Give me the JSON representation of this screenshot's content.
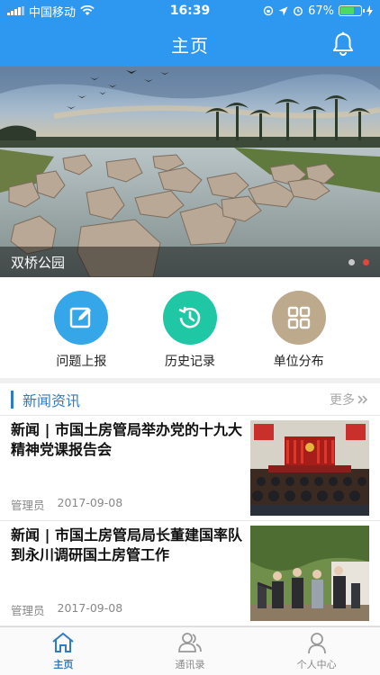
{
  "status_bar": {
    "carrier": "中国移动",
    "time": "16:39",
    "battery": "67%"
  },
  "header": {
    "title": "主页"
  },
  "banner": {
    "caption": "双桥公园",
    "slide_count": 2,
    "active_slide": 2
  },
  "quick_actions": [
    {
      "label": "问题上报",
      "icon": "edit-icon",
      "color": "#35a6e8"
    },
    {
      "label": "历史记录",
      "icon": "history-icon",
      "color": "#1fc7a5"
    },
    {
      "label": "单位分布",
      "icon": "grid-icon",
      "color": "#bda98c"
    }
  ],
  "news": {
    "section_title": "新闻资讯",
    "more_label": "更多",
    "items": [
      {
        "title": "新闻 | 市国土房管局举办党的十九大精神党课报告会",
        "author": "管理员",
        "date": "2017-09-08"
      },
      {
        "title": "新闻 | 市国土房管局局长董建国率队到永川调研国土房管工作",
        "author": "管理员",
        "date": "2017-09-08"
      }
    ]
  },
  "tabs": [
    {
      "label": "主页",
      "active": true
    },
    {
      "label": "通讯录",
      "active": false
    },
    {
      "label": "个人中心",
      "active": false
    }
  ],
  "colors": {
    "primary": "#2e97f0",
    "accent_text": "#2e7cc4",
    "indicator_active": "#e0483e"
  }
}
